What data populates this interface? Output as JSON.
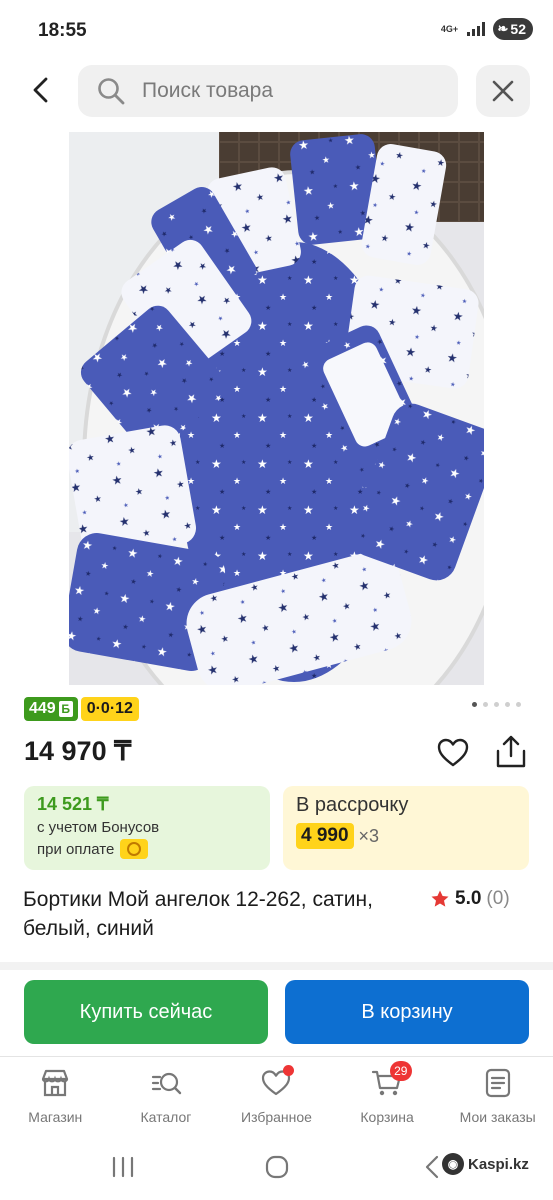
{
  "status_bar": {
    "time": "18:55",
    "network": "4G+",
    "battery": "52"
  },
  "search": {
    "placeholder": "Поиск товара"
  },
  "product": {
    "badges": {
      "bonus": "449",
      "bonus_unit": "Б",
      "installment": "0·0·12"
    },
    "price": "14 970 ₸",
    "bonus_card": {
      "price": "14 521 ₸",
      "line1": "с учетом Бонусов",
      "line2": "при оплате"
    },
    "installment_card": {
      "title": "В рассрочку",
      "amount": "4 990",
      "multiplier": "×3"
    },
    "title": "Бортики Мой ангелок 12-262, сатин, белый, синий",
    "rating": {
      "value": "5.0",
      "count": "(0)"
    },
    "image_alt": "crib-bumpers-stars"
  },
  "actions": {
    "buy_now": "Купить сейчас",
    "add_to_cart": "В корзину"
  },
  "bottom_nav": {
    "items": [
      {
        "label": "Магазин",
        "icon": "store-icon"
      },
      {
        "label": "Каталог",
        "icon": "catalog-search-icon"
      },
      {
        "label": "Избранное",
        "icon": "heart-icon"
      },
      {
        "label": "Корзина",
        "icon": "cart-icon",
        "badge": "29"
      },
      {
        "label": "Мои заказы",
        "icon": "orders-icon"
      }
    ]
  },
  "watermark": {
    "text": "Kaspi.kz"
  },
  "colors": {
    "green": "#2fa84f",
    "blue": "#0d6fd1",
    "yellow": "#ffd31a",
    "bonus_green": "#3d9a1d",
    "red": "#ee3535"
  }
}
